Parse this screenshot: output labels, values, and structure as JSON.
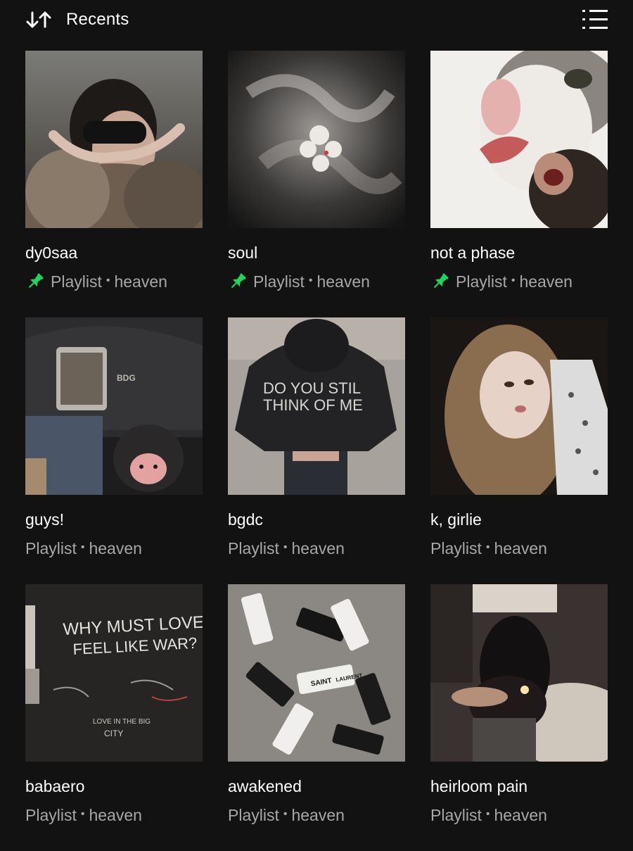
{
  "header": {
    "sort_icon": "sort-arrows-icon",
    "sort_label": "Recents",
    "view_toggle_icon": "list-view-icon"
  },
  "colors": {
    "background": "#121212",
    "text_primary": "#ffffff",
    "text_secondary": "#a7a7a7",
    "pin_accent": "#1ed760"
  },
  "items": [
    {
      "title": "dy0saa",
      "type": "Playlist",
      "owner": "heaven",
      "pinned": true
    },
    {
      "title": "soul",
      "type": "Playlist",
      "owner": "heaven",
      "pinned": true
    },
    {
      "title": "not a phase",
      "type": "Playlist",
      "owner": "heaven",
      "pinned": true
    },
    {
      "title": "guys!",
      "type": "Playlist",
      "owner": "heaven",
      "pinned": false
    },
    {
      "title": "bgdc",
      "type": "Playlist",
      "owner": "heaven",
      "pinned": false
    },
    {
      "title": "k, girlie",
      "type": "Playlist",
      "owner": "heaven",
      "pinned": false
    },
    {
      "title": "babaero",
      "type": "Playlist",
      "owner": "heaven",
      "pinned": false
    },
    {
      "title": "awakened",
      "type": "Playlist",
      "owner": "heaven",
      "pinned": false
    },
    {
      "title": "heirloom pain",
      "type": "Playlist",
      "owner": "heaven",
      "pinned": false
    }
  ],
  "cover_texts": {
    "bgdc": [
      "DO YOU STIL",
      "THINK OF ME"
    ],
    "babaero": [
      "WHY MUST LOVE",
      "FEEL LIKE WAR?",
      "LOVE IN THE BIG",
      "CITY"
    ],
    "guys": [
      "BDG"
    ],
    "awakened": [
      "SAINT",
      "LAURENT"
    ]
  },
  "dot_separator": "•"
}
